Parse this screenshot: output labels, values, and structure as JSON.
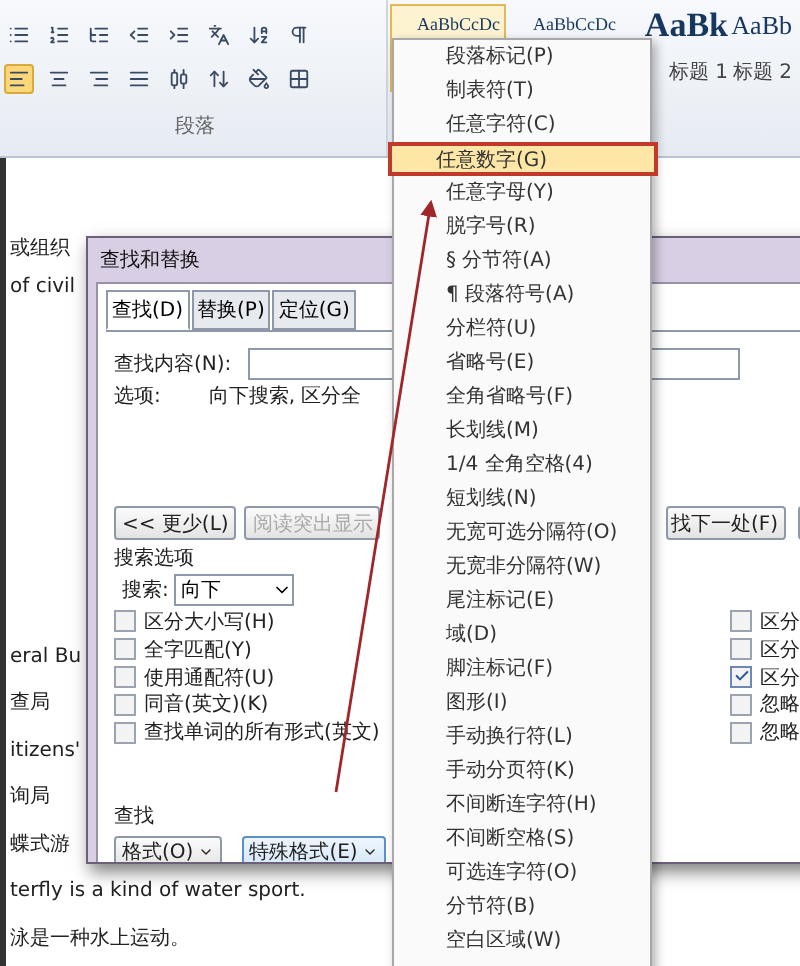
{
  "ribbon": {
    "group_label": "段落",
    "alignment_buttons": [
      {
        "selected": true
      },
      {
        "selected": false
      },
      {
        "selected": false
      },
      {
        "selected": false
      },
      {
        "selected": false
      }
    ],
    "styles": [
      {
        "sample": "AaBbCcDc",
        "selected": true
      },
      {
        "sample": "AaBbCcDc",
        "selected": false
      },
      {
        "sample": "AaBk",
        "label": "标题 1",
        "selected": false
      },
      {
        "sample": "AaBb",
        "label": "标题 2",
        "selected": false
      }
    ]
  },
  "document": {
    "lines_top": [
      "或组织",
      "of civil"
    ],
    "lines_bottom": [
      "eral Bu",
      "查局",
      "itizens'",
      "询局",
      "蝶式游",
      "terfly is a kind of water sport.",
      "泳是一种水上运动。"
    ]
  },
  "dialog": {
    "title": "查找和替换",
    "tabs": [
      {
        "label": "查找(D)",
        "selected": true
      },
      {
        "label": "替换(P)",
        "selected": false
      },
      {
        "label": "定位(G)",
        "selected": false
      }
    ],
    "find_label": "查找内容(N):",
    "options_label": "选项:",
    "options_value": "向下搜索, 区分全",
    "buttons": [
      {
        "label": "<< 更少(L)",
        "disabled": false
      },
      {
        "label": "阅读突出显示",
        "disabled": true
      }
    ],
    "find_next": "找下一处(F)",
    "search_options_title": "搜索选项",
    "search_label": "搜索:",
    "search_value": "向下",
    "checkboxes_left": [
      {
        "label": "区分大小写(H)",
        "checked": false
      },
      {
        "label": "全字匹配(Y)",
        "checked": false
      },
      {
        "label": "使用通配符(U)",
        "checked": false
      },
      {
        "label": "同音(英文)(K)",
        "checked": false
      },
      {
        "label": "查找单词的所有形式(英文)",
        "checked": false
      }
    ],
    "checkboxes_right": [
      {
        "label": "区分",
        "checked": false
      },
      {
        "label": "区分",
        "checked": false
      },
      {
        "label": "区分",
        "checked": true
      },
      {
        "label": "忽略",
        "checked": false
      },
      {
        "label": "忽略",
        "checked": false
      }
    ],
    "find_section_label": "查找",
    "format_button": "格式(O)",
    "special_button": "特殊格式(E)"
  },
  "special_menu": {
    "items": [
      {
        "label": "段落标记(P)",
        "selected": false
      },
      {
        "label": "制表符(T)",
        "selected": false
      },
      {
        "label": "任意字符(C)",
        "selected": false
      },
      {
        "label": "任意数字(G)",
        "selected": true
      },
      {
        "label": "任意字母(Y)",
        "selected": false
      },
      {
        "label": "脱字号(R)",
        "selected": false
      },
      {
        "label": "§ 分节符(A)",
        "selected": false
      },
      {
        "label": "¶ 段落符号(A)",
        "selected": false
      },
      {
        "label": "分栏符(U)",
        "selected": false
      },
      {
        "label": "省略号(E)",
        "selected": false
      },
      {
        "label": "全角省略号(F)",
        "selected": false
      },
      {
        "label": "长划线(M)",
        "selected": false
      },
      {
        "label": "1/4 全角空格(4)",
        "selected": false
      },
      {
        "label": "短划线(N)",
        "selected": false
      },
      {
        "label": "无宽可选分隔符(O)",
        "selected": false
      },
      {
        "label": "无宽非分隔符(W)",
        "selected": false
      },
      {
        "label": "尾注标记(E)",
        "selected": false
      },
      {
        "label": "域(D)",
        "selected": false
      },
      {
        "label": "脚注标记(F)",
        "selected": false
      },
      {
        "label": "图形(I)",
        "selected": false
      },
      {
        "label": "手动换行符(L)",
        "selected": false
      },
      {
        "label": "手动分页符(K)",
        "selected": false
      },
      {
        "label": "不间断连字符(H)",
        "selected": false
      },
      {
        "label": "不间断空格(S)",
        "selected": false
      },
      {
        "label": "可选连字符(O)",
        "selected": false
      },
      {
        "label": "分节符(B)",
        "selected": false
      },
      {
        "label": "空白区域(W)",
        "selected": false
      }
    ]
  }
}
